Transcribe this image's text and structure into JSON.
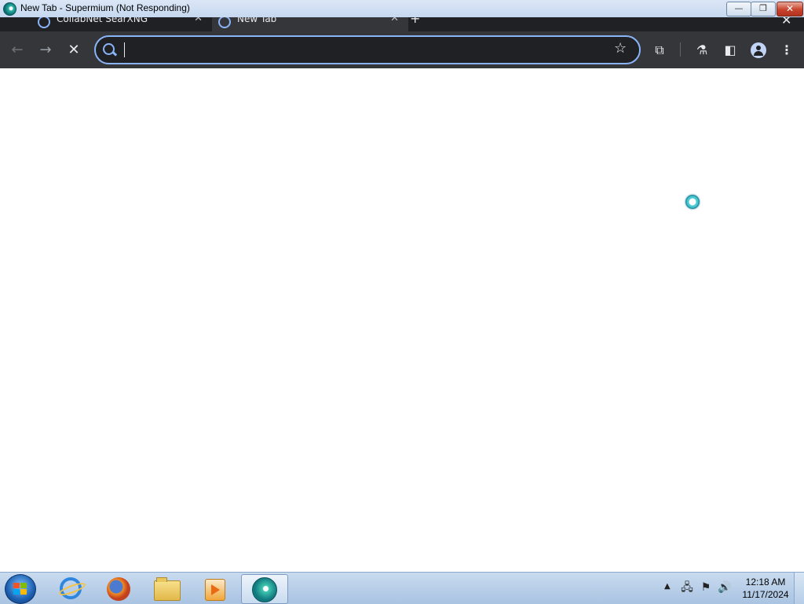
{
  "window": {
    "title": "New Tab - Supermium (Not Responding)",
    "controls": {
      "minimize": "—",
      "restore": "❐",
      "close": "✕"
    }
  },
  "tabs": [
    {
      "label": "CollabNet SearXNG",
      "close": "✕"
    },
    {
      "label": "New Tab",
      "close": "✕"
    }
  ],
  "tabstrip": {
    "new_tab": "+",
    "close": "✕"
  },
  "toolbar": {
    "back": "←",
    "forward": "→",
    "stop": "✕",
    "omnibox": {
      "value": "",
      "placeholder": ""
    },
    "bookmark_star": "☆",
    "extensions": "⧉",
    "labs": "⚗",
    "side_panel": "◧",
    "menu": "⋮"
  },
  "taskbar": {
    "apps": [
      "start-button",
      "internet-explorer",
      "firefox",
      "file-explorer",
      "media-player",
      "supermium"
    ],
    "tray_expand": "▲",
    "clock": {
      "time": "12:18 AM",
      "date": "11/17/2024"
    }
  },
  "colors": {
    "toolbar_bg": "#35363a",
    "tabstrip_bg": "#202124",
    "omnibox_focus": "#8ab4f8",
    "taskbar_bg": "#b9d0ea"
  }
}
